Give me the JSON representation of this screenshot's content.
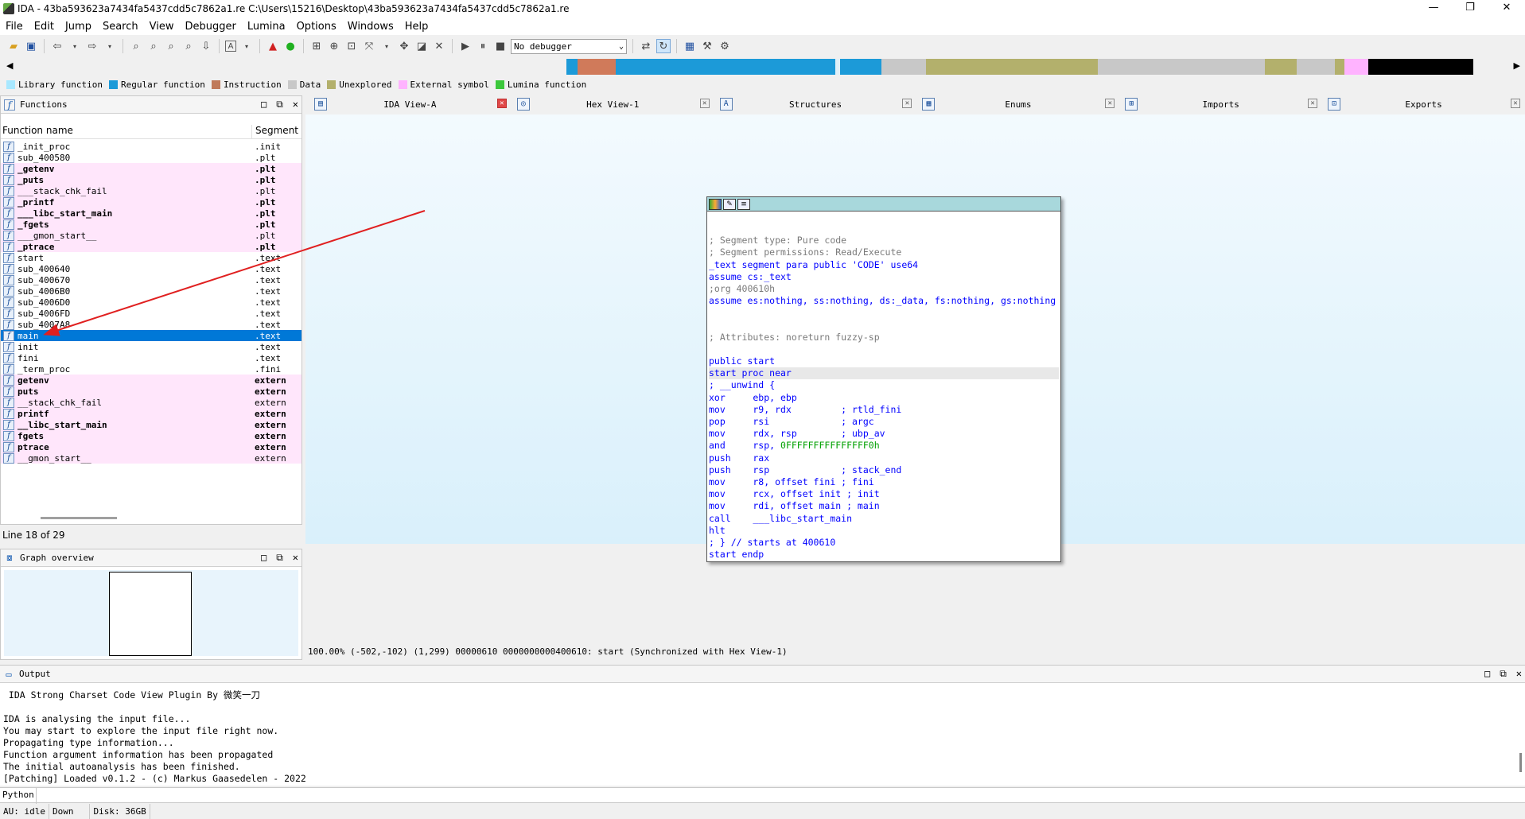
{
  "window": {
    "title": "IDA - 43ba593623a7434fa5437cdd5c7862a1.re C:\\Users\\15216\\Desktop\\43ba593623a7434fa5437cdd5c7862a1.re",
    "minimize": "—",
    "maximize": "❐",
    "close": "✕"
  },
  "menu": [
    "File",
    "Edit",
    "Jump",
    "Search",
    "View",
    "Debugger",
    "Lumina",
    "Options",
    "Windows",
    "Help"
  ],
  "toolbar": {
    "debugger_select": "No debugger"
  },
  "navbar": {
    "segments": [
      {
        "color": "#f0f0f0",
        "w": 0
      },
      {
        "color": "#1c9ad8",
        "w": 14
      },
      {
        "color": "#d07a5a",
        "w": 48
      },
      {
        "color": "#1c9ad8",
        "w": 28
      },
      {
        "color": "#1c9ad8",
        "w": 28
      },
      {
        "color": "#1c9ad8",
        "w": 220
      },
      {
        "color": "#e0f0f8",
        "w": 6
      },
      {
        "color": "#1c9ad8",
        "w": 52
      },
      {
        "color": "#c8c8c8",
        "w": 14
      },
      {
        "color": "#c8c8c8",
        "w": 42
      },
      {
        "color": "#b3b06c",
        "w": 216
      },
      {
        "color": "#c8c8c8",
        "w": 210
      },
      {
        "color": "#b3b06c",
        "w": 40
      },
      {
        "color": "#c8c8c8",
        "w": 48
      },
      {
        "color": "#b3b06c",
        "w": 12
      },
      {
        "color": "#ffb3ff",
        "w": 30
      },
      {
        "color": "#000000",
        "w": 132
      }
    ]
  },
  "legend": [
    {
      "label": "Library function",
      "color": "#a8e8ff"
    },
    {
      "label": "Regular function",
      "color": "#1c9ad8"
    },
    {
      "label": "Instruction",
      "color": "#c07a5a"
    },
    {
      "label": "Data",
      "color": "#c8c8c8"
    },
    {
      "label": "Unexplored",
      "color": "#b3b06c"
    },
    {
      "label": "External symbol",
      "color": "#ffb3ff"
    },
    {
      "label": "Lumina function",
      "color": "#3cc83c"
    }
  ],
  "functions_panel": {
    "title": "Functions",
    "col_name": "Function name",
    "col_segment": "Segment",
    "rows": [
      {
        "name": "_init_proc",
        "seg": ".init",
        "style": "normal"
      },
      {
        "name": "sub_400580",
        "seg": ".plt",
        "style": "normal"
      },
      {
        "name": "_getenv",
        "seg": ".plt",
        "style": "pink-bold"
      },
      {
        "name": "_puts",
        "seg": ".plt",
        "style": "pink-bold"
      },
      {
        "name": "___stack_chk_fail",
        "seg": ".plt",
        "style": "pink"
      },
      {
        "name": "_printf",
        "seg": ".plt",
        "style": "pink-bold"
      },
      {
        "name": "___libc_start_main",
        "seg": ".plt",
        "style": "pink-bold"
      },
      {
        "name": "_fgets",
        "seg": ".plt",
        "style": "pink-bold"
      },
      {
        "name": "___gmon_start__",
        "seg": ".plt",
        "style": "pink"
      },
      {
        "name": "_ptrace",
        "seg": ".plt",
        "style": "pink-bold"
      },
      {
        "name": "start",
        "seg": ".text",
        "style": "normal"
      },
      {
        "name": "sub_400640",
        "seg": ".text",
        "style": "normal"
      },
      {
        "name": "sub_400670",
        "seg": ".text",
        "style": "normal"
      },
      {
        "name": "sub_4006B0",
        "seg": ".text",
        "style": "normal"
      },
      {
        "name": "sub_4006D0",
        "seg": ".text",
        "style": "normal"
      },
      {
        "name": "sub_4006FD",
        "seg": ".text",
        "style": "normal"
      },
      {
        "name": "sub_4007A8",
        "seg": ".text",
        "style": "normal"
      },
      {
        "name": "main",
        "seg": ".text",
        "style": "selected"
      },
      {
        "name": "init",
        "seg": ".text",
        "style": "normal"
      },
      {
        "name": "fini",
        "seg": ".text",
        "style": "normal"
      },
      {
        "name": "_term_proc",
        "seg": ".fini",
        "style": "normal"
      },
      {
        "name": "getenv",
        "seg": "extern",
        "style": "pink-bold"
      },
      {
        "name": "puts",
        "seg": "extern",
        "style": "pink-bold"
      },
      {
        "name": "__stack_chk_fail",
        "seg": "extern",
        "style": "pink"
      },
      {
        "name": "printf",
        "seg": "extern",
        "style": "pink-bold"
      },
      {
        "name": "__libc_start_main",
        "seg": "extern",
        "style": "pink-bold"
      },
      {
        "name": "fgets",
        "seg": "extern",
        "style": "pink-bold"
      },
      {
        "name": "ptrace",
        "seg": "extern",
        "style": "pink-bold"
      },
      {
        "name": "__gmon_start__",
        "seg": "extern",
        "style": "pink"
      }
    ],
    "status": "Line 18 of 29"
  },
  "graph_overview": {
    "title": "Graph overview"
  },
  "tabs": [
    {
      "label": "IDA View-A",
      "icon": "▤",
      "active": true
    },
    {
      "label": "Hex View-1",
      "icon": "◎",
      "active": false
    },
    {
      "label": "Structures",
      "icon": "A",
      "active": false
    },
    {
      "label": "Enums",
      "icon": "▦",
      "active": false
    },
    {
      "label": "Imports",
      "icon": "⊞",
      "active": false
    },
    {
      "label": "Exports",
      "icon": "⊡",
      "active": false
    }
  ],
  "code": [
    {
      "text": "",
      "cls": ""
    },
    {
      "text": "; Segment type: Pure code",
      "cls": "cmt"
    },
    {
      "text": "; Segment permissions: Read/Execute",
      "cls": "cmt"
    },
    {
      "text": "_text segment para public 'CODE' use64",
      "cls": ""
    },
    {
      "text": "assume cs:_text",
      "cls": ""
    },
    {
      "text": ";org 400610h",
      "cls": "cmt"
    },
    {
      "text": "assume es:nothing, ss:nothing, ds:_data, fs:nothing, gs:nothing",
      "cls": ""
    },
    {
      "text": "",
      "cls": ""
    },
    {
      "text": "",
      "cls": ""
    },
    {
      "text": "; Attributes: noreturn fuzzy-sp",
      "cls": "cmt"
    },
    {
      "text": "",
      "cls": ""
    },
    {
      "text": "public start",
      "cls": ""
    },
    {
      "text": "start proc near",
      "cls": "hl"
    },
    {
      "text": "; __unwind {",
      "cls": ""
    },
    {
      "text": "xor     ebp, ebp",
      "cls": ""
    },
    {
      "text": "mov     r9, rdx         ; rtld_fini",
      "cls": ""
    },
    {
      "text": "pop     rsi             ; argc",
      "cls": ""
    },
    {
      "text": "mov     rdx, rsp        ; ubp_av",
      "cls": ""
    },
    {
      "text": "and     rsp, ",
      "num": "0FFFFFFFFFFFFFFF0h",
      "cls": ""
    },
    {
      "text": "push    rax",
      "cls": ""
    },
    {
      "text": "push    rsp             ; stack_end",
      "cls": ""
    },
    {
      "text": "mov     r8, offset fini ; fini",
      "cls": ""
    },
    {
      "text": "mov     rcx, offset init ; init",
      "cls": ""
    },
    {
      "text": "mov     rdi, offset main ; main",
      "cls": ""
    },
    {
      "text": "call    ___libc_start_main",
      "cls": ""
    },
    {
      "text": "hlt",
      "cls": ""
    },
    {
      "text": "; } // starts at 400610",
      "cls": ""
    },
    {
      "text": "start endp",
      "cls": ""
    }
  ],
  "view_status": "100.00% (-502,-102) (1,299) 00000610 0000000000400610: start (Synchronized with Hex View-1)",
  "output_panel": {
    "title": "Output",
    "lines": [
      " IDA Strong Charset Code View Plugin By 微笑一刀",
      "",
      "IDA is analysing the input file...",
      "You may start to explore the input file right now.",
      "Propagating type information...",
      "Function argument information has been propagated",
      "The initial autoanalysis has been finished.",
      "[Patching] Loaded v0.1.2 - (c) Markus Gaasedelen - 2022"
    ]
  },
  "python_label": "Python",
  "statusbar": {
    "au": "AU:  idle",
    "dir": "Down",
    "disk": "Disk: 36GB"
  },
  "panel_buttons": {
    "max": "□",
    "float": "⧉",
    "close": "✕"
  }
}
